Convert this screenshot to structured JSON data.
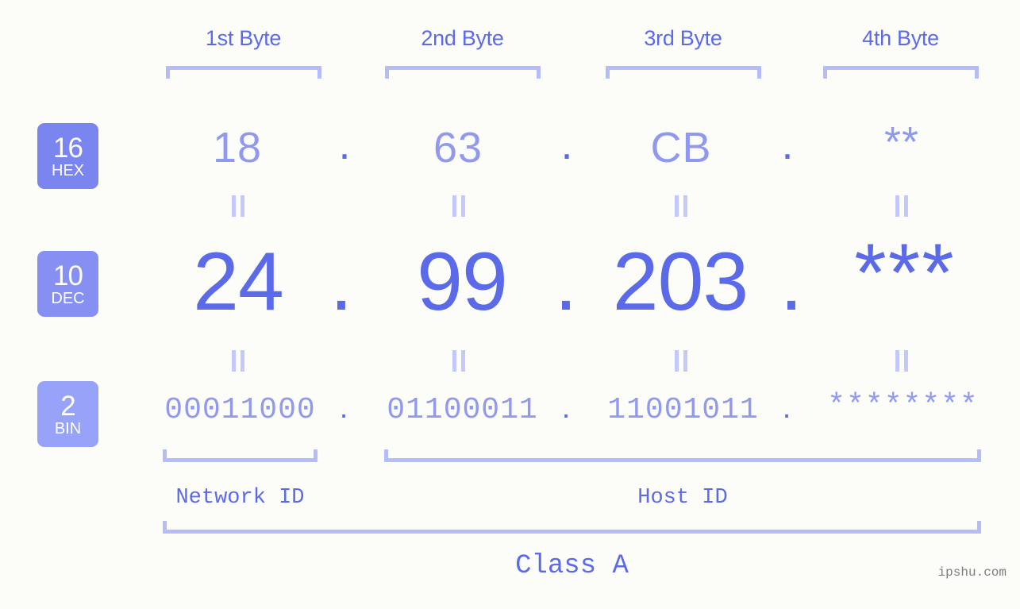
{
  "page": {
    "background": "#fcfdf9",
    "accent": "#5b6ae8",
    "accent_light": "#9099ef",
    "bracket_color": "#b4bcfb",
    "watermark": "ipshu.com"
  },
  "byte_headers": [
    {
      "label": "1st Byte"
    },
    {
      "label": "2nd Byte"
    },
    {
      "label": "3rd Byte"
    },
    {
      "label": "4th Byte"
    }
  ],
  "radix_badges": [
    {
      "number": "16",
      "label": "HEX",
      "color": "#7b85ef"
    },
    {
      "number": "10",
      "label": "DEC",
      "color": "#8690f2"
    },
    {
      "number": "2",
      "label": "BIN",
      "color": "#97a3f8"
    }
  ],
  "rows": {
    "hex": {
      "values": [
        "18",
        "63",
        "CB",
        "**"
      ],
      "separator": "."
    },
    "dec": {
      "values": [
        "24",
        "99",
        "203",
        "***"
      ],
      "separator": "."
    },
    "bin": {
      "values": [
        "00011000",
        "01100011",
        "11001011",
        "********"
      ],
      "separator": "."
    }
  },
  "equals_symbol": "=",
  "segments": {
    "network_id": "Network ID",
    "host_id": "Host ID",
    "class": "Class A"
  }
}
